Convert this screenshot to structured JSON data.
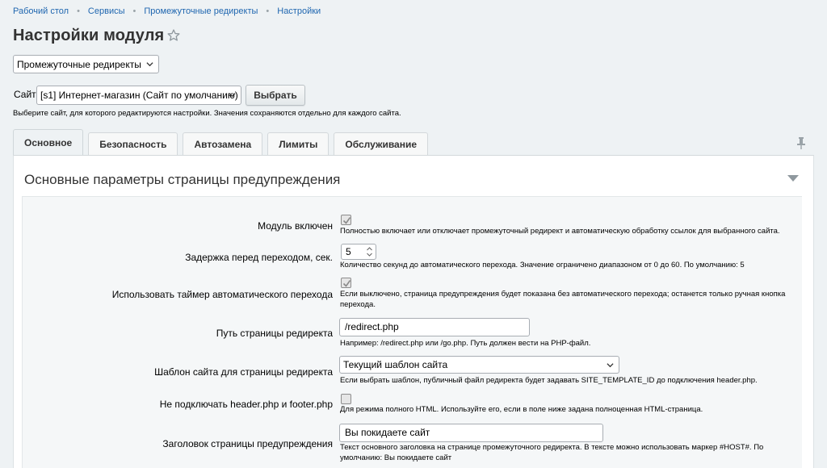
{
  "breadcrumb": [
    "Рабочий стол",
    "Сервисы",
    "Промежуточные редиректы",
    "Настройки"
  ],
  "page_title": "Настройки модуля",
  "module_select": {
    "value": "Промежуточные редиректы"
  },
  "site": {
    "label": "Сайт",
    "value": "[s1] Интернет-магазин (Сайт по умолчанию)",
    "button": "Выбрать",
    "hint": "Выберите сайт, для которого редактируются настройки. Значения сохраняются отдельно для каждого сайта."
  },
  "tabs": [
    "Основное",
    "Безопасность",
    "Автозамена",
    "Лимиты",
    "Обслуживание"
  ],
  "section_title": "Основные параметры страницы предупреждения",
  "fields": {
    "module_enabled": {
      "label": "Модуль включен",
      "checked": true,
      "hint": "Полностью включает или отключает промежуточный редирект и автоматическую обработку ссылок для выбранного сайта."
    },
    "delay": {
      "label": "Задержка перед переходом, сек.",
      "value": "5",
      "hint": "Количество секунд до автоматического перехода. Значение ограничено диапазоном от 0 до 60. По умолчанию: 5"
    },
    "use_timer": {
      "label": "Использовать таймер автоматического перехода",
      "checked": true,
      "hint": "Если выключено, страница предупреждения будет показана без автоматического перехода; останется только ручная кнопка перехода."
    },
    "redirect_path": {
      "label": "Путь страницы редиректа",
      "value": "/redirect.php",
      "hint": "Например: /redirect.php или /go.php. Путь должен вести на PHP-файл."
    },
    "template": {
      "label": "Шаблон сайта для страницы редиректа",
      "value": "Текущий шаблон сайта",
      "hint": "Если выбрать шаблон, публичный файл редиректа будет задавать SITE_TEMPLATE_ID до подключения header.php."
    },
    "no_header": {
      "label": "Не подключать header.php и footer.php",
      "checked": false,
      "hint": "Для режима полного HTML. Используйте его, если в поле ниже задана полноценная HTML-страница."
    },
    "warning_title": {
      "label": "Заголовок страницы предупреждения",
      "value": "Вы покидаете сайт",
      "hint": "Текст основного заголовка на странице промежуточного редиректа. В тексте можно использовать маркер #HOST#. По умолчанию: Вы покидаете сайт"
    }
  },
  "colors": {
    "link": "#2067b0",
    "page_bg": "#eef2f4",
    "form_bg": "#f5f7f8"
  }
}
